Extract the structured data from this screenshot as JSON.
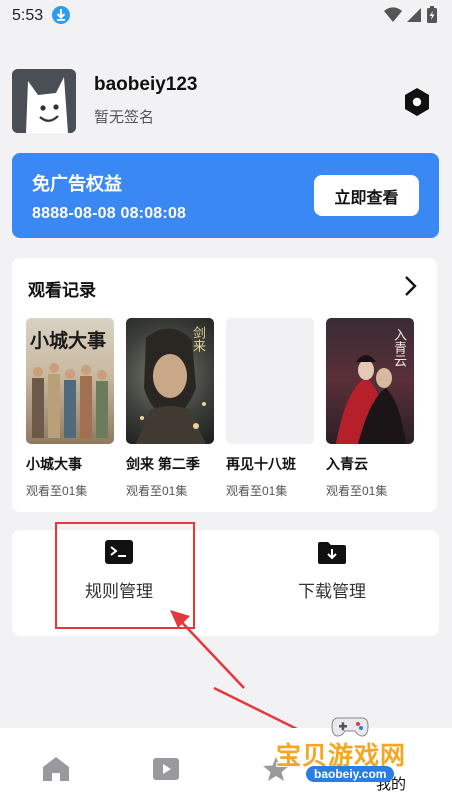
{
  "status_bar": {
    "time": "5:53"
  },
  "profile": {
    "username": "baobeiy123",
    "signature": "暂无签名"
  },
  "ad_banner": {
    "title": "免广告权益",
    "expiry": "8888-08-08 08:08:08",
    "button_label": "立即查看",
    "color": "#3a88f3"
  },
  "history": {
    "title": "观看记录",
    "items": [
      {
        "title": "小城大事",
        "progress": "观看至01集",
        "poster_text": "小城大事"
      },
      {
        "title": "剑来 第二季",
        "progress": "观看至01集",
        "poster_text": "剑来"
      },
      {
        "title": "再见十八班",
        "progress": "观看至01集",
        "poster_text": ""
      },
      {
        "title": "入青云",
        "progress": "观看至01集",
        "poster_text": "入青云"
      }
    ]
  },
  "tools": {
    "rules": {
      "label": "规则管理",
      "icon": "terminal-icon"
    },
    "downloads": {
      "label": "下载管理",
      "icon": "download-folder-icon"
    }
  },
  "bottom_nav": {
    "mine_label": "我的"
  },
  "watermark": {
    "text": "宝贝游戏网",
    "url": "baobeiy.com"
  },
  "colors": {
    "accent": "#3a88f3",
    "annotation": "#e5383b",
    "background": "#f2f2f4"
  }
}
